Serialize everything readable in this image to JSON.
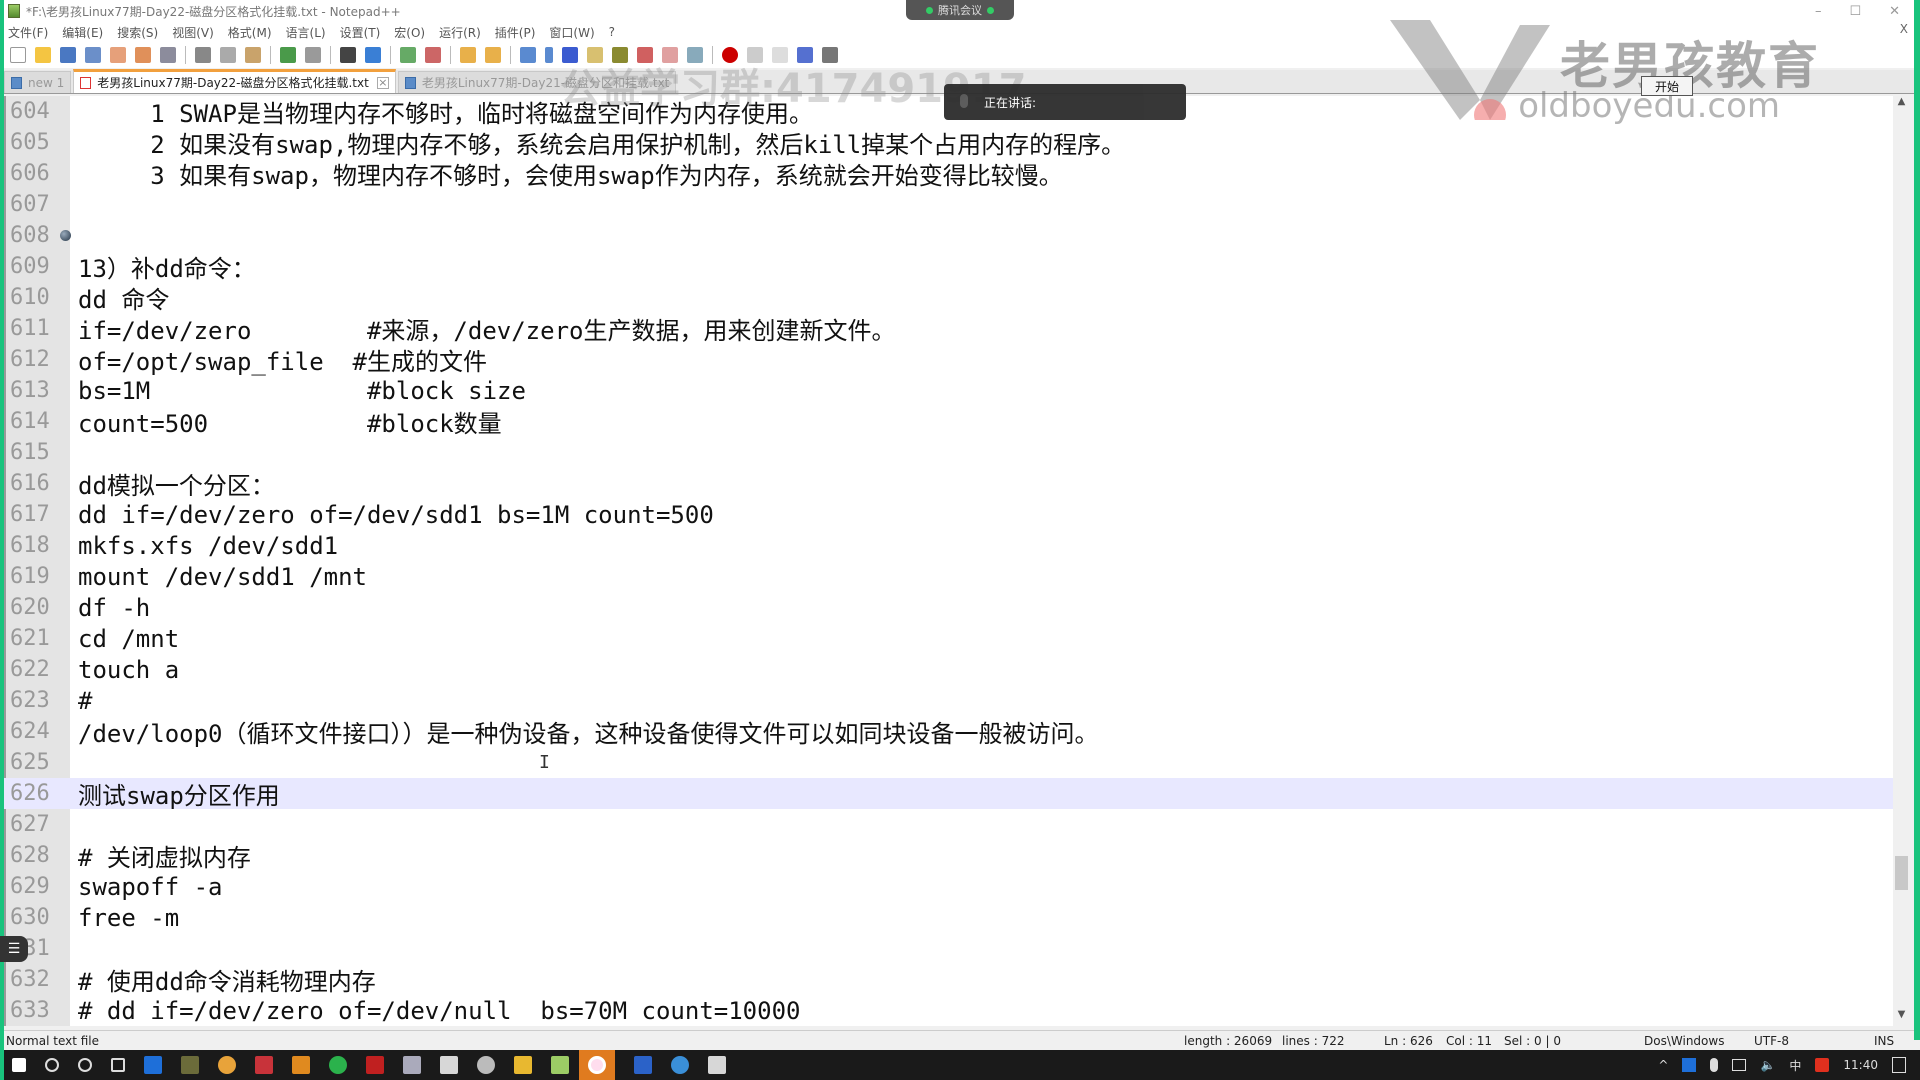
{
  "window": {
    "title": "*F:\\老男孩Linux77期-Day22-磁盘分区格式化挂载.txt - Notepad++",
    "controls": [
      "–",
      "☐",
      "✕"
    ]
  },
  "menu": [
    "文件(F)",
    "编辑(E)",
    "搜索(S)",
    "视图(V)",
    "格式(M)",
    "语言(L)",
    "设置(T)",
    "宏(O)",
    "运行(R)",
    "插件(P)",
    "窗口(W)",
    "?"
  ],
  "menu_close": "X",
  "toolbar": {
    "icons": [
      "new-file",
      "open-file",
      "save",
      "save-all",
      "close",
      "close-all",
      "print",
      "cut",
      "copy",
      "paste",
      "undo",
      "redo",
      "find",
      "replace",
      "zoom-in",
      "zoom-out",
      "sync-vertical",
      "sync-horizontal",
      "word-wrap",
      "show-all-chars",
      "indent-guide",
      "user-defined-lang",
      "doc-map",
      "function-list",
      "folder-workspace",
      "monitoring",
      "record-macro",
      "stop-record",
      "play-macro",
      "run-macro-multiple",
      "save-macro"
    ]
  },
  "tabs": [
    {
      "label": "new 1",
      "active": false
    },
    {
      "label": "老男孩Linux77期-Day22-磁盘分区格式化挂载.txt",
      "active": true
    },
    {
      "label": "老男孩Linux77期-Day21-磁盘分区和挂载.txt",
      "active": false
    }
  ],
  "editor": {
    "lines": [
      {
        "num": "604",
        "text": "     1 SWAP是当物理内存不够时，临时将磁盘空间作为内存使用。"
      },
      {
        "num": "605",
        "text": "     2 如果没有swap,物理内存不够，系统会启用保护机制，然后kill掉某个占用内存的程序。"
      },
      {
        "num": "606",
        "text": "     3 如果有swap，物理内存不够时，会使用swap作为内存，系统就会开始变得比较慢。"
      },
      {
        "num": "607",
        "text": ""
      },
      {
        "num": "608",
        "text": "",
        "bookmark": true
      },
      {
        "num": "609",
        "text": "13）补dd命令："
      },
      {
        "num": "610",
        "text": "dd 命令"
      },
      {
        "num": "611",
        "text": "if=/dev/zero        #来源，/dev/zero生产数据，用来创建新文件。"
      },
      {
        "num": "612",
        "text": "of=/opt/swap_file  #生成的文件"
      },
      {
        "num": "613",
        "text": "bs=1M               #block size"
      },
      {
        "num": "614",
        "text": "count=500           #block数量"
      },
      {
        "num": "615",
        "text": ""
      },
      {
        "num": "616",
        "text": "dd模拟一个分区："
      },
      {
        "num": "617",
        "text": "dd if=/dev/zero of=/dev/sdd1 bs=1M count=500"
      },
      {
        "num": "618",
        "text": "mkfs.xfs /dev/sdd1"
      },
      {
        "num": "619",
        "text": "mount /dev/sdd1 /mnt"
      },
      {
        "num": "620",
        "text": "df -h"
      },
      {
        "num": "621",
        "text": "cd /mnt"
      },
      {
        "num": "622",
        "text": "touch a"
      },
      {
        "num": "623",
        "text": "#"
      },
      {
        "num": "624",
        "text": "/dev/loop0（循环文件接口））是一种伪设备，这种设备使得文件可以如同块设备一般被访问。"
      },
      {
        "num": "625",
        "text": ""
      },
      {
        "num": "626",
        "text": "测试swap分区作用",
        "current": true
      },
      {
        "num": "627",
        "text": ""
      },
      {
        "num": "628",
        "text": "# 关闭虚拟内存"
      },
      {
        "num": "629",
        "text": "swapoff -a"
      },
      {
        "num": "630",
        "text": "free -m"
      },
      {
        "num": "631",
        "text": ""
      },
      {
        "num": "632",
        "text": "# 使用dd命令消耗物理内存"
      },
      {
        "num": "633",
        "text": "# dd if=/dev/zero of=/dev/null  bs=70M count=10000"
      }
    ]
  },
  "statusbar": {
    "file_type": "Normal text file",
    "length": "length : 26069",
    "lines": "lines : 722",
    "ln": "Ln : 626",
    "col": "Col : 11",
    "sel": "Sel : 0 | 0",
    "eol": "Dos\\Windows",
    "encoding": "UTF-8",
    "mode": "INS"
  },
  "overlays": {
    "meeting_app": "腾讯会议",
    "speaking_label": "正在讲话:",
    "start_button": "开始",
    "watermark_brand": "老男孩教育",
    "watermark_url": "oldboyedu.com",
    "watermark_group": "公益学习群:417491917"
  },
  "taskbar": {
    "apps": [
      "start",
      "search",
      "cortana",
      "task-view",
      "app-blue",
      "app-tree",
      "chrome",
      "app-red",
      "app-window",
      "wechat",
      "app-penguin",
      "app-tool",
      "app-doc",
      "app-gear",
      "file-explorer",
      "notepad++",
      "app-orange-active",
      "word",
      "ie",
      "app-doc2"
    ],
    "tray": [
      "^",
      "ime-icon",
      "mic-icon",
      "network-icon",
      "volume-icon",
      "中",
      "sogou-icon"
    ],
    "time": "11:40",
    "notification": "notification-icon"
  },
  "colors": {
    "tab_active_accent": "#f2a03d",
    "current_line": "#e8e8ff",
    "frame_green": "#19c37d"
  }
}
